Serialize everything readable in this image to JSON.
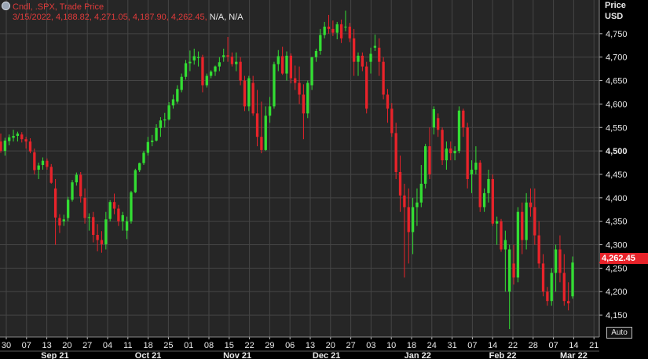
{
  "legend": {
    "line1": "Cndl, .SPX, Trade Price",
    "line2_ohlc": "3/15/2022, 4,188.82, 4,271.05, 4,187.90, 4,262.45,",
    "line2_na": " N/A, N/A"
  },
  "axis_header": {
    "line1": "Price",
    "line2": "USD"
  },
  "auto_button_label": "Auto",
  "last_price_label": "4,262.45",
  "colors": {
    "background": "#000000",
    "plot_background": "#262626",
    "grid": "#454545",
    "up_candle": "#33dd33",
    "down_candle": "#e8232a",
    "axis_text": "#e8e8e8",
    "last_price_badge": "#e8232a"
  },
  "chart_data": {
    "type": "candlestick",
    "title": "Cndl, .SPX, Trade Price",
    "ylabel": "Price USD",
    "ylim": [
      4115,
      4805
    ],
    "y_ticks": [
      {
        "value": 4150,
        "label": "4,150"
      },
      {
        "value": 4200,
        "label": "4,200"
      },
      {
        "value": 4250,
        "label": "4,250"
      },
      {
        "value": 4300,
        "label": "4,300"
      },
      {
        "value": 4350,
        "label": "4,350"
      },
      {
        "value": 4400,
        "label": "4,400"
      },
      {
        "value": 4450,
        "label": "4,450"
      },
      {
        "value": 4500,
        "label": "4,500"
      },
      {
        "value": 4550,
        "label": "4,550"
      },
      {
        "value": 4600,
        "label": "4,600"
      },
      {
        "value": 4650,
        "label": "4,650"
      },
      {
        "value": 4700,
        "label": "4,700"
      },
      {
        "value": 4750,
        "label": "4,750"
      }
    ],
    "x_day_ticks": [
      {
        "label": "30",
        "week": 0
      },
      {
        "label": "07",
        "week": 1
      },
      {
        "label": "13",
        "week": 2
      },
      {
        "label": "20",
        "week": 3
      },
      {
        "label": "27",
        "week": 4
      },
      {
        "label": "04",
        "week": 5
      },
      {
        "label": "11",
        "week": 6
      },
      {
        "label": "18",
        "week": 7
      },
      {
        "label": "25",
        "week": 8
      },
      {
        "label": "01",
        "week": 9
      },
      {
        "label": "08",
        "week": 10
      },
      {
        "label": "15",
        "week": 11
      },
      {
        "label": "22",
        "week": 12
      },
      {
        "label": "29",
        "week": 13
      },
      {
        "label": "06",
        "week": 14
      },
      {
        "label": "13",
        "week": 15
      },
      {
        "label": "20",
        "week": 16
      },
      {
        "label": "27",
        "week": 17
      },
      {
        "label": "03",
        "week": 18
      },
      {
        "label": "10",
        "week": 19
      },
      {
        "label": "18",
        "week": 20
      },
      {
        "label": "24",
        "week": 21
      },
      {
        "label": "31",
        "week": 22
      },
      {
        "label": "07",
        "week": 23
      },
      {
        "label": "14",
        "week": 24
      },
      {
        "label": "22",
        "week": 25
      },
      {
        "label": "28",
        "week": 26
      },
      {
        "label": "07",
        "week": 27
      },
      {
        "label": "14",
        "week": 28
      },
      {
        "label": "21",
        "week": 29
      }
    ],
    "x_month_labels": [
      {
        "label": "Sep 21",
        "week": 2.4
      },
      {
        "label": "Oct 21",
        "week": 7.0
      },
      {
        "label": "Nov 21",
        "week": 11.4
      },
      {
        "label": "Dec 21",
        "week": 15.8
      },
      {
        "label": "Jan 22",
        "week": 20.3
      },
      {
        "label": "Feb 22",
        "week": 24.5
      },
      {
        "label": "Mar 22",
        "week": 28.0
      }
    ],
    "candles": [
      [
        4520,
        4537,
        4496,
        4500
      ],
      [
        4500,
        4528,
        4490,
        4522
      ],
      [
        4521,
        4535,
        4512,
        4529
      ],
      [
        4528,
        4545,
        4520,
        4532
      ],
      [
        4532,
        4541,
        4520,
        4537
      ],
      [
        4535,
        4540,
        4518,
        4525
      ],
      [
        4525,
        4530,
        4505,
        4520
      ],
      [
        4520,
        4527,
        4495,
        4499
      ],
      [
        4497,
        4505,
        4450,
        4459
      ],
      [
        4460,
        4475,
        4440,
        4469
      ],
      [
        4470,
        4486,
        4460,
        4479
      ],
      [
        4479,
        4484,
        4460,
        4466
      ],
      [
        4466,
        4472,
        4430,
        4432
      ],
      [
        4420,
        4440,
        4300,
        4358
      ],
      [
        4357,
        4365,
        4325,
        4341
      ],
      [
        4350,
        4364,
        4340,
        4354
      ],
      [
        4357,
        4402,
        4350,
        4396
      ],
      [
        4396,
        4438,
        4392,
        4433
      ],
      [
        4433,
        4454,
        4426,
        4449
      ],
      [
        4449,
        4455,
        4390,
        4403
      ],
      [
        4400,
        4420,
        4345,
        4357
      ],
      [
        4357,
        4367,
        4330,
        4359
      ],
      [
        4359,
        4370,
        4305,
        4321
      ],
      [
        4321,
        4344,
        4286,
        4310
      ],
      [
        4310,
        4329,
        4283,
        4301
      ],
      [
        4301,
        4370,
        4290,
        4354
      ],
      [
        4355,
        4395,
        4350,
        4391
      ],
      [
        4391,
        4409,
        4365,
        4377
      ],
      [
        4377,
        4385,
        4340,
        4350
      ],
      [
        4350,
        4370,
        4330,
        4363
      ],
      [
        4330,
        4360,
        4312,
        4350
      ],
      [
        4350,
        4415,
        4345,
        4412
      ],
      [
        4412,
        4462,
        4410,
        4459
      ],
      [
        4459,
        4475,
        4455,
        4474
      ],
      [
        4474,
        4500,
        4470,
        4496
      ],
      [
        4496,
        4530,
        4490,
        4519
      ],
      [
        4519,
        4534,
        4510,
        4522
      ],
      [
        4522,
        4557,
        4520,
        4549
      ],
      [
        4549,
        4572,
        4530,
        4565
      ],
      [
        4565,
        4581,
        4550,
        4567
      ],
      [
        4567,
        4604,
        4565,
        4597
      ],
      [
        4597,
        4620,
        4590,
        4610
      ],
      [
        4605,
        4640,
        4601,
        4632
      ],
      [
        4630,
        4665,
        4625,
        4658
      ],
      [
        4658,
        4694,
        4652,
        4687
      ],
      [
        4687,
        4714,
        4670,
        4690
      ],
      [
        4693,
        4718,
        4684,
        4702
      ],
      [
        4698,
        4712,
        4680,
        4700
      ],
      [
        4700,
        4705,
        4625,
        4640
      ],
      [
        4640,
        4665,
        4635,
        4660
      ],
      [
        4660,
        4672,
        4655,
        4669
      ],
      [
        4669,
        4682,
        4660,
        4680
      ],
      [
        4680,
        4700,
        4670,
        4689
      ],
      [
        4700,
        4718,
        4690,
        4704
      ],
      [
        4704,
        4743,
        4690,
        4701
      ],
      [
        4701,
        4710,
        4680,
        4685
      ],
      [
        4685,
        4710,
        4670,
        4690
      ],
      [
        4690,
        4700,
        4640,
        4650
      ],
      [
        4650,
        4660,
        4585,
        4595
      ],
      [
        4595,
        4660,
        4585,
        4655
      ],
      [
        4645,
        4660,
        4575,
        4580
      ],
      [
        4580,
        4630,
        4510,
        4530
      ],
      [
        4530,
        4605,
        4495,
        4502
      ],
      [
        4502,
        4595,
        4500,
        4575
      ],
      [
        4575,
        4615,
        4560,
        4595
      ],
      [
        4595,
        4690,
        4590,
        4685
      ],
      [
        4685,
        4715,
        4670,
        4702
      ],
      [
        4702,
        4722,
        4662,
        4665
      ],
      [
        4665,
        4712,
        4650,
        4703
      ],
      [
        4703,
        4708,
        4644,
        4655
      ],
      [
        4655,
        4682,
        4630,
        4645
      ],
      [
        4645,
        4680,
        4600,
        4620
      ],
      [
        4620,
        4642,
        4525,
        4580
      ],
      [
        4580,
        4650,
        4570,
        4645
      ],
      [
        4640,
        4700,
        4630,
        4700
      ],
      [
        4700,
        4718,
        4690,
        4713
      ],
      [
        4713,
        4760,
        4705,
        4747
      ],
      [
        4747,
        4775,
        4740,
        4765
      ],
      [
        4765,
        4790,
        4750,
        4760
      ],
      [
        4760,
        4778,
        4745,
        4752
      ],
      [
        4752,
        4775,
        4738,
        4770
      ],
      [
        4770,
        4780,
        4730,
        4740
      ],
      [
        4765,
        4799,
        4755,
        4765
      ],
      [
        4765,
        4773,
        4732,
        4740
      ],
      [
        4740,
        4760,
        4660,
        4690
      ],
      [
        4690,
        4710,
        4660,
        4703
      ],
      [
        4703,
        4710,
        4670,
        4680
      ],
      [
        4680,
        4690,
        4580,
        4590
      ],
      [
        4690,
        4720,
        4665,
        4707
      ],
      [
        4720,
        4748,
        4713,
        4724
      ],
      [
        4720,
        4740,
        4660,
        4690
      ],
      [
        4690,
        4700,
        4610,
        4620
      ],
      [
        4620,
        4632,
        4560,
        4590
      ],
      [
        4590,
        4602,
        4530,
        4538
      ],
      [
        4538,
        4560,
        4440,
        4455
      ],
      [
        4455,
        4490,
        4370,
        4405
      ],
      [
        4405,
        4430,
        4230,
        4380
      ],
      [
        4380,
        4420,
        4260,
        4327
      ],
      [
        4327,
        4400,
        4280,
        4380
      ],
      [
        4380,
        4420,
        4340,
        4390
      ],
      [
        4390,
        4470,
        4380,
        4430
      ],
      [
        4430,
        4515,
        4420,
        4510
      ],
      [
        4510,
        4550,
        4440,
        4450
      ],
      [
        4550,
        4595,
        4535,
        4589
      ],
      [
        4570,
        4580,
        4530,
        4545
      ],
      [
        4545,
        4550,
        4470,
        4480
      ],
      [
        4480,
        4520,
        4460,
        4505
      ],
      [
        4505,
        4520,
        4480,
        4495
      ],
      [
        4495,
        4510,
        4480,
        4500
      ],
      [
        4500,
        4595,
        4495,
        4586
      ],
      [
        4586,
        4590,
        4530,
        4550
      ],
      [
        4550,
        4560,
        4420,
        4440
      ],
      [
        4450,
        4480,
        4410,
        4460
      ],
      [
        4460,
        4510,
        4450,
        4475
      ],
      [
        4475,
        4480,
        4370,
        4380
      ],
      [
        4380,
        4420,
        4370,
        4410
      ],
      [
        4410,
        4460,
        4390,
        4440
      ],
      [
        4440,
        4450,
        4340,
        4345
      ],
      [
        4345,
        4360,
        4300,
        4350
      ],
      [
        4350,
        4355,
        4285,
        4290
      ],
      [
        4290,
        4330,
        4200,
        4310
      ],
      [
        4200,
        4300,
        4120,
        4290
      ],
      [
        4260,
        4300,
        4215,
        4230
      ],
      [
        4230,
        4380,
        4220,
        4370
      ],
      [
        4370,
        4390,
        4280,
        4310
      ],
      [
        4310,
        4410,
        4290,
        4390
      ],
      [
        4390,
        4420,
        4360,
        4380
      ],
      [
        4380,
        4420,
        4300,
        4320
      ],
      [
        4320,
        4350,
        4250,
        4260
      ],
      [
        4260,
        4280,
        4190,
        4200
      ],
      [
        4200,
        4210,
        4170,
        4180
      ],
      [
        4180,
        4250,
        4170,
        4240
      ],
      [
        4240,
        4300,
        4200,
        4290
      ],
      [
        4290,
        4320,
        4220,
        4240
      ],
      [
        4240,
        4280,
        4170,
        4180
      ],
      [
        4180,
        4220,
        4160,
        4175
      ],
      [
        4190,
        4275,
        4185,
        4262
      ]
    ]
  }
}
